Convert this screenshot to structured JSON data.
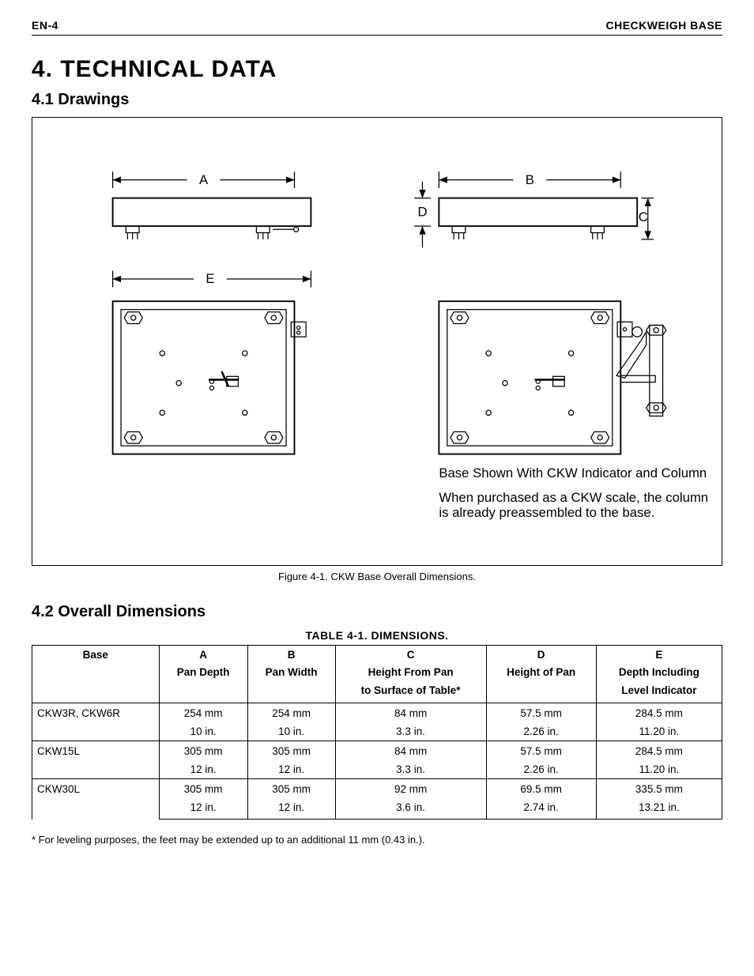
{
  "header": {
    "left": "EN-4",
    "right": "CHECKWEIGH BASE"
  },
  "section": {
    "title": "4. TECHNICAL DATA",
    "sub1": "4.1 Drawings",
    "sub2": "4.2 Overall Dimensions"
  },
  "figure": {
    "caption": "Figure 4-1. CKW Base Overall Dimensions.",
    "labels": {
      "A": "A",
      "B": "B",
      "C": "C",
      "D": "D",
      "E": "E"
    },
    "note1": "Base Shown With CKW Indicator and Column.",
    "note2a": "When purchased as a CKW scale, the column",
    "note2b": "is already preassembled to the base."
  },
  "table": {
    "title": "TABLE 4-1. DIMENSIONS.",
    "headers": {
      "base": "Base",
      "A": "A",
      "B": "B",
      "C": "C",
      "D": "D",
      "E": "E",
      "A2": "Pan Depth",
      "B2": "Pan Width",
      "C2a": "Height From Pan",
      "C2b": "to Surface of Table*",
      "D2": "Height of Pan",
      "E2a": "Depth Including",
      "E2b": "Level Indicator"
    },
    "rows": [
      {
        "base": "CKW3R, CKW6R",
        "A_mm": "254 mm",
        "A_in": "10 in.",
        "B_mm": "254 mm",
        "B_in": "10 in.",
        "C_mm": "84 mm",
        "C_in": "3.3 in.",
        "D_mm": "57.5 mm",
        "D_in": "2.26 in.",
        "E_mm": "284.5 mm",
        "E_in": "11.20 in."
      },
      {
        "base": "CKW15L",
        "A_mm": "305 mm",
        "A_in": "12 in.",
        "B_mm": "305 mm",
        "B_in": "12 in.",
        "C_mm": "84 mm",
        "C_in": "3.3 in.",
        "D_mm": "57.5 mm",
        "D_in": "2.26 in.",
        "E_mm": "284.5 mm",
        "E_in": "11.20 in."
      },
      {
        "base": "CKW30L",
        "A_mm": "305 mm",
        "A_in": "12 in.",
        "B_mm": "305 mm",
        "B_in": "12 in.",
        "C_mm": "92 mm",
        "C_in": "3.6 in.",
        "D_mm": "69.5 mm",
        "D_in": "2.74 in.",
        "E_mm": "335.5 mm",
        "E_in": "13.21 in."
      }
    ]
  },
  "footnote": "* For leveling purposes, the feet may be extended up to an additional 11 mm (0.43 in.)."
}
